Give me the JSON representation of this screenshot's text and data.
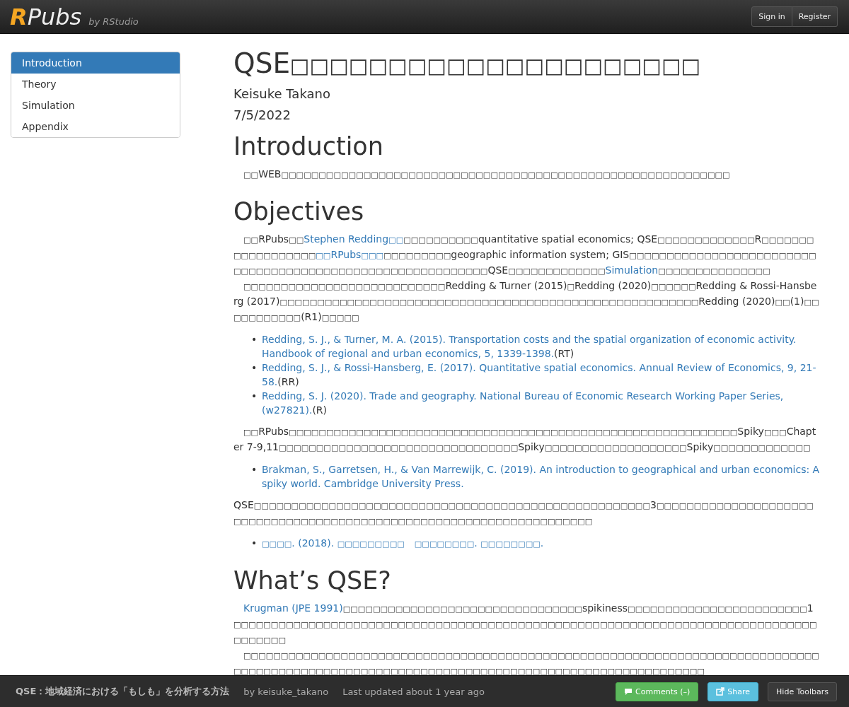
{
  "header": {
    "logo": {
      "mark": "R",
      "name": "Pubs",
      "byline": "by RStudio"
    },
    "buttons": [
      "Sign in",
      "Register"
    ]
  },
  "sidebar": {
    "items": [
      {
        "label": "Introduction",
        "selected": true
      },
      {
        "label": "Theory",
        "selected": false
      },
      {
        "label": "Simulation",
        "selected": false
      },
      {
        "label": "Appendix",
        "selected": false
      }
    ]
  },
  "document": {
    "title": "QSE□□□□□□□□□□□□□□□□□□□□□",
    "author": "Keisuke Takano",
    "date": "7/5/2022",
    "blocks": [
      {
        "kind": "heading",
        "text": "Introduction"
      },
      {
        "kind": "paragraph",
        "parts": [
          {
            "kind": "indented",
            "segments": [
              {
                "kind": "text",
                "text": "□□WEB□□□□□□□□□□□□□□□□□□□□□□□□□□□□□□□□□□□□□□□□□□□□□□□□□□□□□□□□□□□□"
              }
            ]
          }
        ]
      },
      {
        "kind": "heading",
        "text": "Objectives"
      },
      {
        "kind": "paragraph",
        "parts": [
          {
            "kind": "indented",
            "segments": [
              {
                "kind": "text",
                "text": "□□RPubs□□"
              },
              {
                "kind": "link",
                "text": "Stephen Redding□□"
              },
              {
                "kind": "text",
                "text": "□□□□□□□□□□quantitative spatial economics; QSE□□□□□□□□□□□□□R□□□□□□□□□□□□□□□□□□"
              },
              {
                "kind": "link",
                "text": "□□RPubs□□□"
              },
              {
                "kind": "text",
                "text": "□□□□□□□□□geographic information system; GIS□□□□□□□□□□□□□□□□□□□□□□□□□□□□□□□□□□□□□□□□□□□□□□□□□□□□□□□□□□□QSE□□□□□□□□□□□□□"
              },
              {
                "kind": "link",
                "text": "Simulation"
              },
              {
                "kind": "text",
                "text": "□□□□□□□□□□□□□□□"
              }
            ]
          },
          {
            "kind": "indented",
            "segments": [
              {
                "kind": "text",
                "text": "□□□□□□□□□□□□□□□□□□□□□□□□□□□Redding & Turner (2015)□Redding (2020)□□□□□□Redding & Rossi-Hansberg (2017)□□□□□□□□□□□□□□□□□□□□□□□□□□□□□□□□□□□□□□□□□□□□□□□□□□□□□□□□Redding (2020)□□(1)□□□□□□□□□□□(R1)□□□□□"
              }
            ]
          }
        ]
      },
      {
        "kind": "list",
        "items": [
          {
            "marker": "•",
            "segments": [
              {
                "kind": "link",
                "text": "Redding, S. J., & Turner, M. A. (2015). Transportation costs and the spatial organization of economic activity."
              },
              {
                "kind": "link",
                "text": "Handbook of regional and urban economics, 5, 1339-1398."
              },
              {
                "kind": "text",
                "text": "(RT)"
              }
            ]
          },
          {
            "marker": "•",
            "segments": [
              {
                "kind": "link",
                "text": "Redding, S. J., & Rossi-Hansberg, E. (2017). Quantitative spatial economics. Annual Review of Economics, 9, 21-"
              },
              {
                "kind": "link",
                "text": "58."
              },
              {
                "kind": "text",
                "text": "(RR)"
              }
            ]
          },
          {
            "marker": "•",
            "segments": [
              {
                "kind": "link",
                "text": "Redding, S. J. (2020). Trade and geography. National Bureau of Economic Research Working Paper Series,"
              },
              {
                "kind": "link",
                "text": "(w27821)."
              },
              {
                "kind": "text",
                "text": "(R)"
              }
            ]
          }
        ]
      },
      {
        "kind": "paragraph",
        "parts": [
          {
            "kind": "indented",
            "segments": [
              {
                "kind": "text",
                "text": "□□RPubs□□□□□□□□□□□□□□□□□□□□□□□□□□□□□□□□□□□□□□□□□□□□□□□□□□□□□□□□□□□□Spiky□□□Chapter 7-9,11□□□□□□□□□□□□□□□□□□□□□□□□□□□□□□□□Spiky□□□□□□□□□□□□□□□□□□□Spiky□□□□□□□□□□□□□"
              }
            ]
          }
        ]
      },
      {
        "kind": "list",
        "items": [
          {
            "marker": "•",
            "segments": [
              {
                "kind": "link",
                "text": "Brakman, S., Garretsen, H., & Van Marrewijk, C. (2019). An introduction to geographical and urban economics: A"
              },
              {
                "kind": "link",
                "text": "spiky world. Cambridge University Press."
              }
            ]
          }
        ]
      },
      {
        "kind": "paragraph",
        "parts": [
          {
            "kind": "flush",
            "segments": [
              {
                "kind": "text",
                "text": "QSE□□□□□□□□□□□□□□□□□□□□□□□□□□□□□□□□□□□□□□□□□□□□□□□□□□□□□3□□□□□□□□□□□□□□□□□□□□□□□□□□□□□□□□□□□□□□□□□□□□□□□□□□□□□□□□□□□□□□□□□□□□□"
              }
            ]
          }
        ]
      },
      {
        "kind": "list",
        "items": [
          {
            "marker": "•",
            "segments": [
              {
                "kind": "link",
                "text": "□□□□. (2018). □□□□□□□□□　□□□□□□□□. □□□□□□□□."
              }
            ]
          }
        ]
      },
      {
        "kind": "heading",
        "text": "What’s QSE?"
      },
      {
        "kind": "paragraph",
        "parts": [
          {
            "kind": "indented",
            "segments": [
              {
                "kind": "link",
                "text": "Krugman (JPE 1991)"
              },
              {
                "kind": "text",
                "text": "□□□□□□□□□□□□□□□□□□□□□□□□□□□□□□□□spikiness□□□□□□□□□□□□□□□□□□□□□□□□1□□□□□□□□□□□□□□□□□□□□□□□□□□□□□□□□□□□□□□□□□□□□□□□□□□□□□□□□□□□□□□□□□□□□□□□□□□□□□□□□□□□□□"
              }
            ]
          },
          {
            "kind": "indented",
            "segments": [
              {
                "kind": "text",
                "text": "□□□□□□□□□□□□□□□□□□□□□□□□□□□□□□□□□□□□□□□□□□□□□□□□□□□□□□□□□□□□□□□□□□□□□□□□□□□□□□□□□□□□□□□□□□□□□□□□□□□□□□□□□□□□□□□□□□□□□□□□□□□□□□□□□□□□□□□□□□□□"
              }
            ]
          }
        ]
      }
    ]
  },
  "footer": {
    "title": "QSE：地域経済における「もしも」を分析する方法",
    "author": "by keisuke_takano",
    "updated": "Last updated about 1 year ago",
    "buttons": [
      {
        "label": "Comments (–)",
        "kind": "comments"
      },
      {
        "label": "Share",
        "kind": "share"
      },
      {
        "label": "Hide Toolbars",
        "kind": "plain"
      }
    ]
  }
}
